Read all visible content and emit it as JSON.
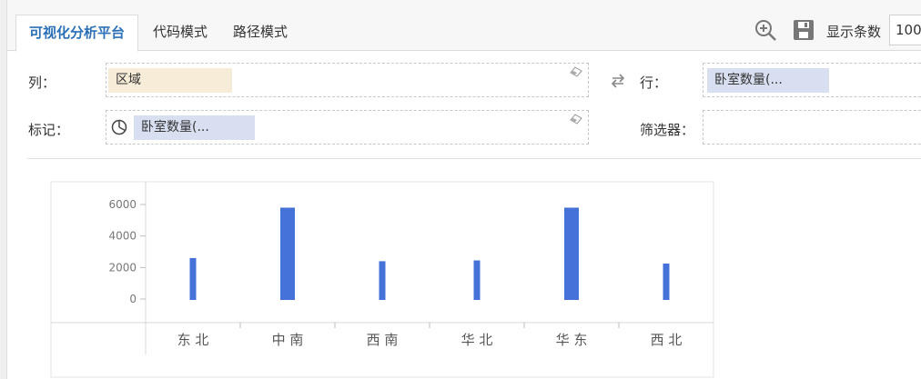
{
  "tabs": [
    {
      "label": "可视化分析平台",
      "active": true
    },
    {
      "label": "代码模式",
      "active": false
    },
    {
      "label": "路径模式",
      "active": false
    }
  ],
  "toolbar": {
    "zoom_icon": "zoom-in-icon",
    "save_icon": "save-icon",
    "count_label": "显示条数",
    "count_value": "100"
  },
  "shelves": {
    "columns": {
      "label": "列：",
      "pill": "区域"
    },
    "rows": {
      "label": "行：",
      "pill": "卧室数量(..."
    },
    "marks": {
      "label": "标记：",
      "pill": "卧室数量(..."
    },
    "filters": {
      "label": "筛选器："
    }
  },
  "colors": {
    "accent": "#2a6fb8",
    "bar": "#4472d8",
    "dimension_pill": "#f6ecd8",
    "measure_pill": "#d7dff0"
  },
  "chart_data": {
    "type": "bar",
    "categories": [
      "东 北",
      "中 南",
      "西 南",
      "华 北",
      "华 东",
      "西 北"
    ],
    "values": [
      2600,
      5800,
      2400,
      2450,
      5800,
      2250
    ],
    "yticks": [
      0,
      2000,
      4000,
      6000
    ],
    "ylim": [
      0,
      6000
    ],
    "grid": false,
    "title": "",
    "xlabel": "",
    "ylabel": ""
  }
}
